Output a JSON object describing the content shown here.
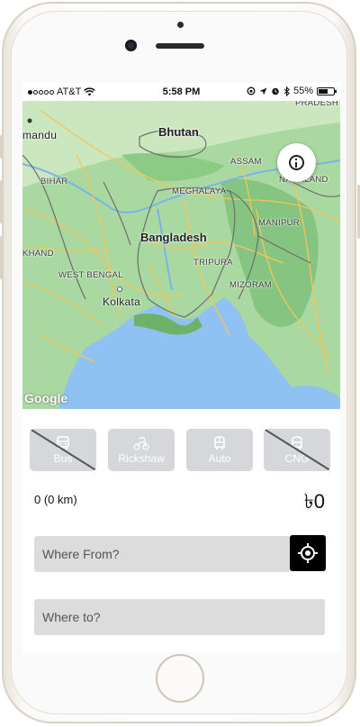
{
  "status": {
    "carrier": "AT&T",
    "time": "5:58 PM",
    "battery": "55%"
  },
  "map": {
    "labels": {
      "pradesh": "PRADESH",
      "mandu": "mandu",
      "bhutan": "Bhutan",
      "assam": "ASSAM",
      "nagaland": "NAGALAND",
      "bihar": "BIHAR",
      "meghalaya": "MEGHALAYA",
      "manipur": "MANIPUR",
      "bangladesh": "Bangladesh",
      "khand": "KHAND",
      "tripura": "TRIPURA",
      "west_bengal": "WEST BENGAL",
      "mizoram": "MIZORAM",
      "kolkata": "Kolkata"
    },
    "attribution": "Google",
    "info_icon": "info-icon"
  },
  "vehicles": [
    {
      "label": "Bus",
      "icon": "bus-icon"
    },
    {
      "label": "Rickshaw",
      "icon": "rickshaw-icon"
    },
    {
      "label": "Auto",
      "icon": "auto-icon"
    },
    {
      "label": "CNG",
      "icon": "cng-icon"
    }
  ],
  "trip": {
    "distance": "0 (0 km)",
    "fare": "৳0"
  },
  "inputs": {
    "from_placeholder": "Where From?",
    "to_placeholder": "Where to?"
  },
  "colors": {
    "button_bg": "#d6d7da",
    "field_bg": "#dcdcdc",
    "locate_bg": "#000000",
    "water": "#8fc2f3",
    "land": "#9fd39a"
  }
}
